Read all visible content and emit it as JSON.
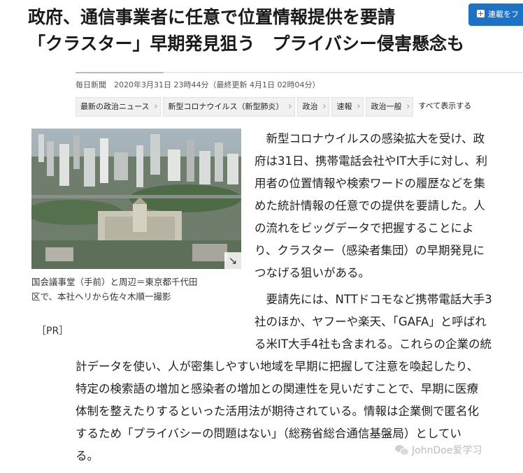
{
  "headline": {
    "line1": "政府、通信事業者に任意で位置情報提供を要請",
    "line2": "「クラスター」早期発見狙う　プライバシー侵害懸念も"
  },
  "follow_button": {
    "label": "連載をフ",
    "icon": "plus-in-box-icon"
  },
  "meta": "毎日新聞　2020年3月31日 23時44分（最終更新 4月1日 02時04分）",
  "tags": [
    {
      "label": "最新の政治ニュース"
    },
    {
      "label": "新型コロナウイルス（新型肺炎）"
    },
    {
      "label": "政治"
    },
    {
      "label": "速報"
    },
    {
      "label": "政治一般"
    }
  ],
  "tags_all_label": "すべて表示する",
  "photo": {
    "caption_line1": "国会議事堂（手前）と周辺＝東京都千代田",
    "caption_line2": "区で、本社ヘリから佐々木順一撮影",
    "expand_icon": "expand-arrow-icon"
  },
  "pr_label": "［PR］",
  "article": {
    "p1_lines": [
      "　新型コロナウイルスの感染拡大を受け、政",
      "府は31日、携帯電話会社やIT大手に対し、利",
      "用者の位置情報や検索ワードの履歴などを集",
      "めた統計情報の任意での提供を要請した。人",
      "の流れをビッグデータで把握することによ",
      "り、クラスター（感染者集団）の早期発見に",
      "つなげる狙いがある。"
    ],
    "p2_lines_narrow": [
      "　要請先には、NTTドコモなど携帯電話大手3",
      "社のほか、ヤフーや楽天、「GAFA」と呼ばれ",
      "る米IT大手4社も含まれる。これらの企業の統"
    ],
    "p2_lines_wide": [
      "計データを使い、人が密集しやすい地域を早期に把握して注意を喚起したり、",
      "特定の検索語の増加と感染者の増加との関連性を見いだすことで、早期に医療",
      "体制を整えたりするといった活用法が期待されている。情報は企業側で匿名化",
      "するため「プライバシーの問題はない」（総務省総合通信基盤局）としてい",
      "る。"
    ]
  },
  "watermark": "JohnDoe爱学习"
}
